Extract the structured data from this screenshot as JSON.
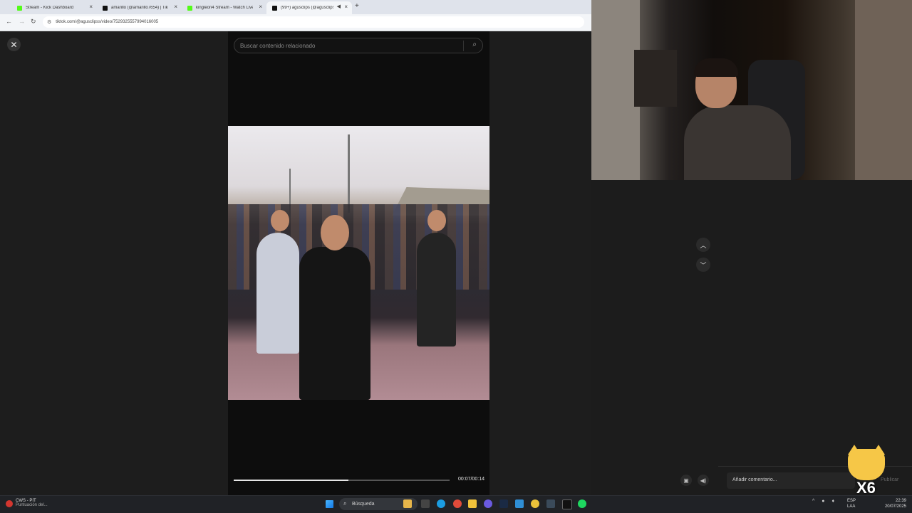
{
  "browser": {
    "tabs": [
      {
        "label": "Stream - Kick Dashboard",
        "icon": "kick-icon",
        "active": false
      },
      {
        "label": "amarillo (@amarillo7654) | TikTok",
        "icon": "tiktok-icon",
        "active": false
      },
      {
        "label": "kingleon4 Stream - Watch Live",
        "icon": "kick-icon",
        "active": false
      },
      {
        "label": "(99+) agusclips (@agusclips",
        "icon": "tiktok-icon",
        "active": true
      }
    ],
    "tab_close_glyph": "×",
    "new_tab_glyph": "+",
    "url": "tiktok.com/@agusclipss/video/7529325557994016005"
  },
  "player": {
    "search_placeholder": "Buscar contenido relacionado",
    "progress_fraction": 0.53,
    "timecode": "00:07/00:14"
  },
  "right_panel": {
    "comment_placeholder": "Añadir comentario...",
    "publish_label": "Publicar"
  },
  "overlay": {
    "badge_text": "X6",
    "badge_color": "#f6c747"
  },
  "taskbar": {
    "weather_title": "CWS - PIT",
    "weather_subtitle": "Puntuación del...",
    "search_label": "Búsqueda",
    "lang_line1": "ESP",
    "lang_line2": "LAA",
    "time": "22:39",
    "date": "20/07/2025"
  },
  "colors": {
    "kick_green": "#53fc18",
    "page_bg": "#1d1d1d",
    "player_bg": "#0d0d0d"
  }
}
